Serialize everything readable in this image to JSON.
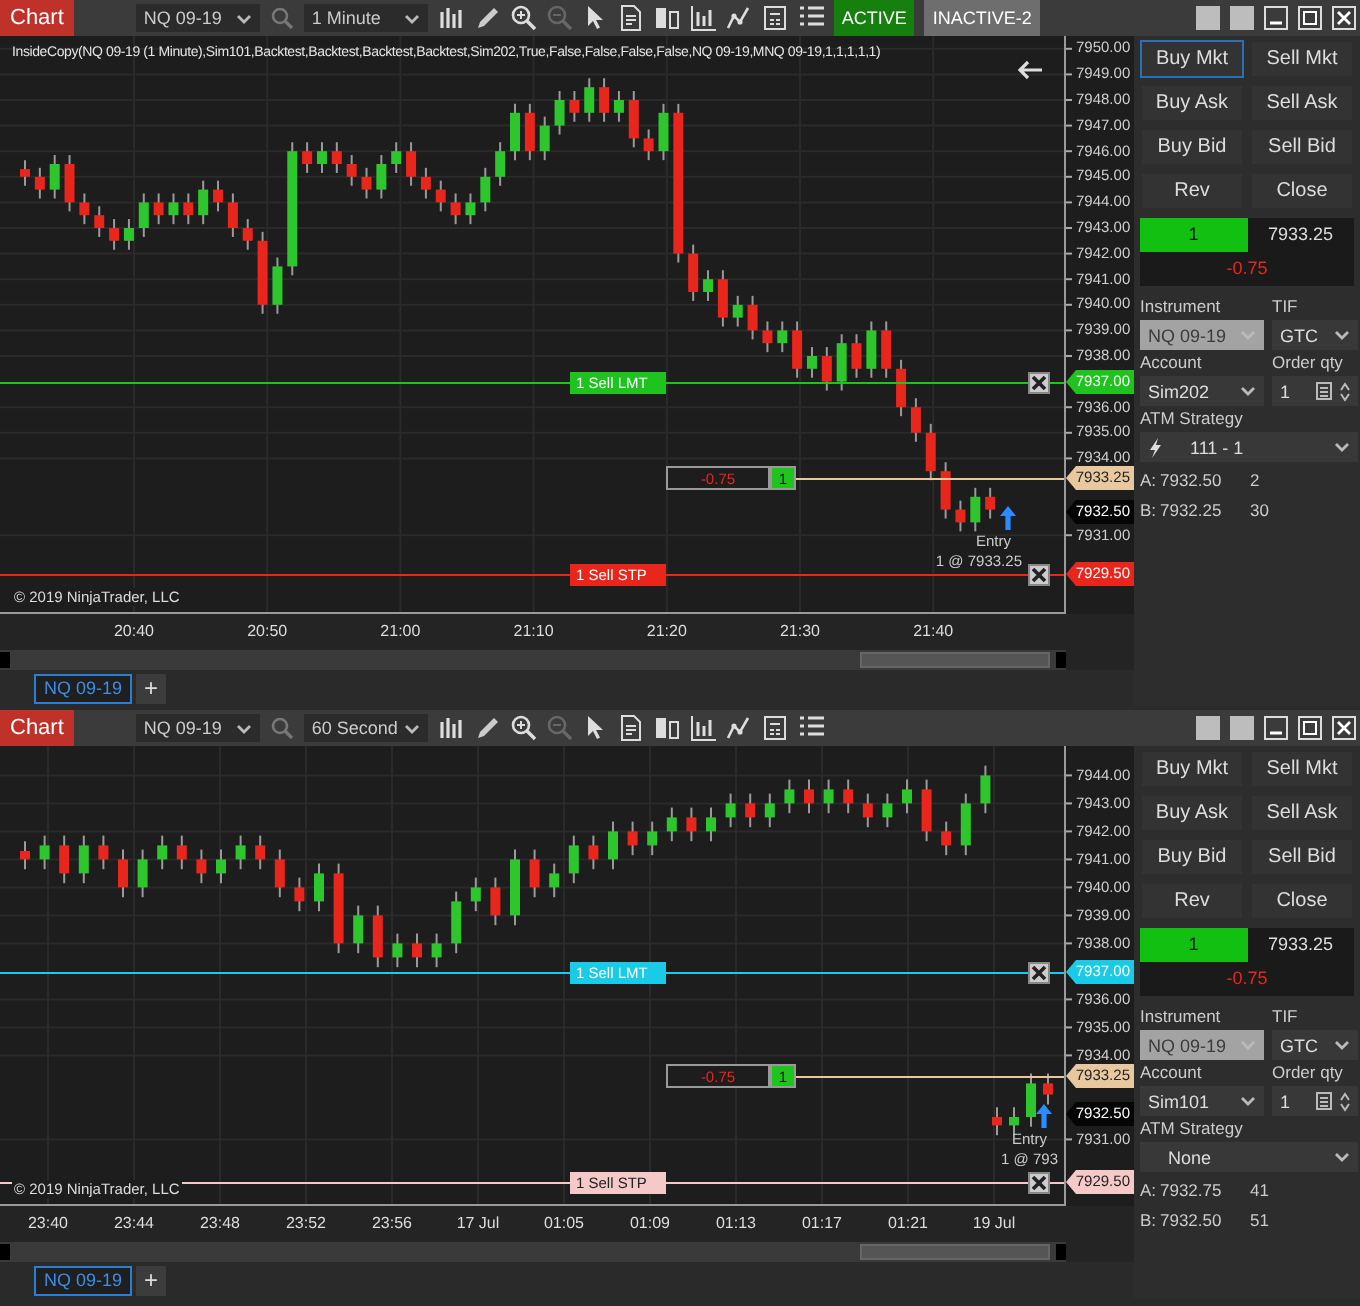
{
  "panels": [
    {
      "toolbar": {
        "app_button": "Chart",
        "instrument": "NQ 09-19",
        "interval": "1 Minute",
        "badges": [
          {
            "label": "ACTIVE",
            "kind": "active"
          },
          {
            "label": "INACTIVE-2",
            "kind": "inactive"
          }
        ]
      },
      "chart": {
        "indicator_label": "InsideCopy(NQ 09-19 (1 Minute),Sim101,Backtest,Backtest,Backtest,Backtest,Sim202,True,False,False,False,False,NQ 09-19,MNQ 09-19,1,1,1,1,1)",
        "back_arrow": true,
        "copyright": "© 2019 NinjaTrader, LLC",
        "price_labels": [
          "7950.00",
          "7949.00",
          "7948.00",
          "7947.00",
          "7946.00",
          "7945.00",
          "7944.00",
          "7943.00",
          "7942.00",
          "7941.00",
          "7940.00",
          "7939.00",
          "7938.00",
          "7936.00",
          "7935.00",
          "7934.00",
          "7931.00"
        ],
        "time_labels": [
          "20:40",
          "20:50",
          "21:00",
          "21:10",
          "21:20",
          "21:30",
          "21:40"
        ],
        "orders": [
          {
            "label": "1  Sell LMT",
            "price": "7937.00",
            "color": "#1ec31e"
          },
          {
            "label": "1  Sell STP",
            "price": "7929.50",
            "color": "#e8261c"
          }
        ],
        "position": {
          "pnl": "-0.75",
          "qty": "1",
          "price": "7933.25"
        },
        "last_price": "7932.50",
        "execution": {
          "label": "Entry",
          "detail": "1 @ 7933.25"
        }
      },
      "tabs": [
        {
          "label": "NQ 09-19",
          "selected": true
        }
      ],
      "add_tab": "+",
      "order_panel": {
        "buttons": [
          {
            "label": "Buy Mkt",
            "selected": true
          },
          {
            "label": "Sell Mkt",
            "selected": false
          },
          {
            "label": "Buy Ask",
            "selected": false
          },
          {
            "label": "Sell Ask",
            "selected": false
          },
          {
            "label": "Buy Bid",
            "selected": false
          },
          {
            "label": "Sell Bid",
            "selected": false
          },
          {
            "label": "Rev",
            "selected": false
          },
          {
            "label": "Close",
            "selected": false
          }
        ],
        "position": {
          "qty": "1",
          "price": "7933.25",
          "pnl": "-0.75"
        },
        "fields": [
          {
            "label": "Instrument",
            "value": "NQ 09-19",
            "kind": "select",
            "disabled": true
          },
          {
            "label": "TIF",
            "value": "GTC",
            "kind": "select",
            "disabled": false
          },
          {
            "label": "Account",
            "value": "Sim202",
            "kind": "select",
            "disabled": false
          },
          {
            "label": "Order qty",
            "value": "1",
            "kind": "spinner",
            "disabled": false
          },
          {
            "label": "ATM Strategy",
            "value": "111 - 1",
            "kind": "atm",
            "disabled": false,
            "has_template": true
          }
        ],
        "quotes": [
          {
            "label": "A:",
            "price": "7932.50",
            "size": "2"
          },
          {
            "label": "B:",
            "price": "7932.25",
            "size": "30"
          }
        ]
      }
    },
    {
      "toolbar": {
        "app_button": "Chart",
        "instrument": "NQ 09-19",
        "interval": "60 Second"
      },
      "chart": {
        "copyright": "© 2019 NinjaTrader, LLC",
        "price_labels": [
          "7944.00",
          "7943.00",
          "7942.00",
          "7941.00",
          "7940.00",
          "7939.00",
          "7938.00",
          "7936.00",
          "7935.00",
          "7934.00",
          "7931.00"
        ],
        "time_labels": [
          "23:40",
          "23:44",
          "23:48",
          "23:52",
          "23:56",
          "17 Jul",
          "01:05",
          "01:09",
          "01:13",
          "01:17",
          "01:21",
          "19 Jul"
        ],
        "orders": [
          {
            "label": "1  Sell LMT",
            "price": "7937.00",
            "color": "#19cbe6"
          },
          {
            "label": "1  Sell STP",
            "price": "7929.50",
            "color": "#f6c9c9"
          }
        ],
        "position": {
          "pnl": "-0.75",
          "qty": "1",
          "price": "7933.25"
        },
        "last_price": "7932.50",
        "execution": {
          "label": "Entry",
          "detail": "1 @ 793"
        }
      },
      "tabs": [
        {
          "label": "NQ 09-19",
          "selected": true
        }
      ],
      "add_tab": "+",
      "order_panel": {
        "buttons": [
          {
            "label": "Buy Mkt",
            "selected": false
          },
          {
            "label": "Sell Mkt",
            "selected": false
          },
          {
            "label": "Buy Ask",
            "selected": false
          },
          {
            "label": "Sell Ask",
            "selected": false
          },
          {
            "label": "Buy Bid",
            "selected": false
          },
          {
            "label": "Sell Bid",
            "selected": false
          },
          {
            "label": "Rev",
            "selected": false
          },
          {
            "label": "Close",
            "selected": false
          }
        ],
        "position": {
          "qty": "1",
          "price": "7933.25",
          "pnl": "-0.75"
        },
        "fields": [
          {
            "label": "Instrument",
            "value": "NQ 09-19",
            "kind": "select",
            "disabled": true
          },
          {
            "label": "TIF",
            "value": "GTC",
            "kind": "select",
            "disabled": false
          },
          {
            "label": "Account",
            "value": "Sim101",
            "kind": "select",
            "disabled": false
          },
          {
            "label": "Order qty",
            "value": "1",
            "kind": "spinner",
            "disabled": false
          },
          {
            "label": "ATM Strategy",
            "value": "None",
            "kind": "atm",
            "disabled": false,
            "has_template": false
          }
        ],
        "quotes": [
          {
            "label": "A:",
            "price": "7932.75",
            "size": "41"
          },
          {
            "label": "B:",
            "price": "7932.50",
            "size": "51"
          }
        ]
      }
    }
  ]
}
